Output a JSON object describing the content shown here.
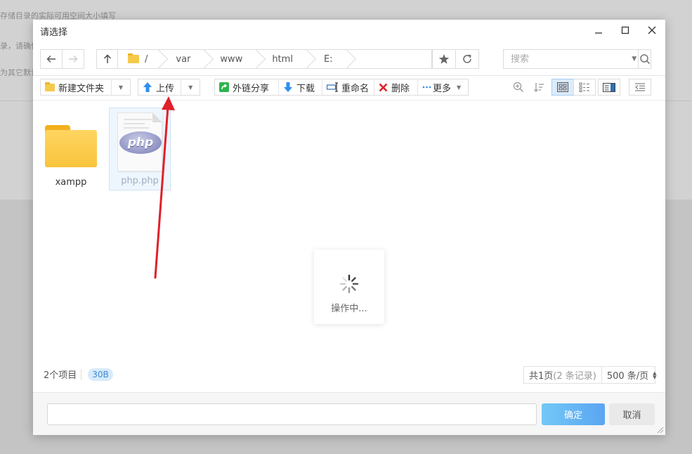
{
  "background": {
    "lines": [
      "存储目录的实际可用空间大小填写",
      "录，请确保",
      "为其它默认"
    ]
  },
  "dialog": {
    "title": "请选择",
    "breadcrumbs": [
      "/",
      "var",
      "www",
      "html",
      "E:"
    ],
    "search": {
      "placeholder": "搜索"
    },
    "toolbar": {
      "new_folder": "新建文件夹",
      "upload": "上传",
      "share": "外链分享",
      "download": "下载",
      "rename": "重命名",
      "delete": "删除",
      "more": "更多"
    },
    "files": [
      {
        "name": "xampp",
        "type": "folder",
        "selected": false
      },
      {
        "name": "php.php",
        "type": "php",
        "selected": true
      }
    ],
    "loading_text": "操作中...",
    "status": {
      "item_count": "2个项目",
      "size": "30B",
      "page_info": "共1页",
      "record_info": "(2 条记录)",
      "page_size": "500 条/页"
    },
    "footer": {
      "path_value": "",
      "ok_label": "确定",
      "cancel_label": "取消"
    }
  },
  "colors": {
    "accent": "#5aa5f2",
    "annotation_arrow": "#e0202a",
    "folder": "#f8c43d"
  }
}
